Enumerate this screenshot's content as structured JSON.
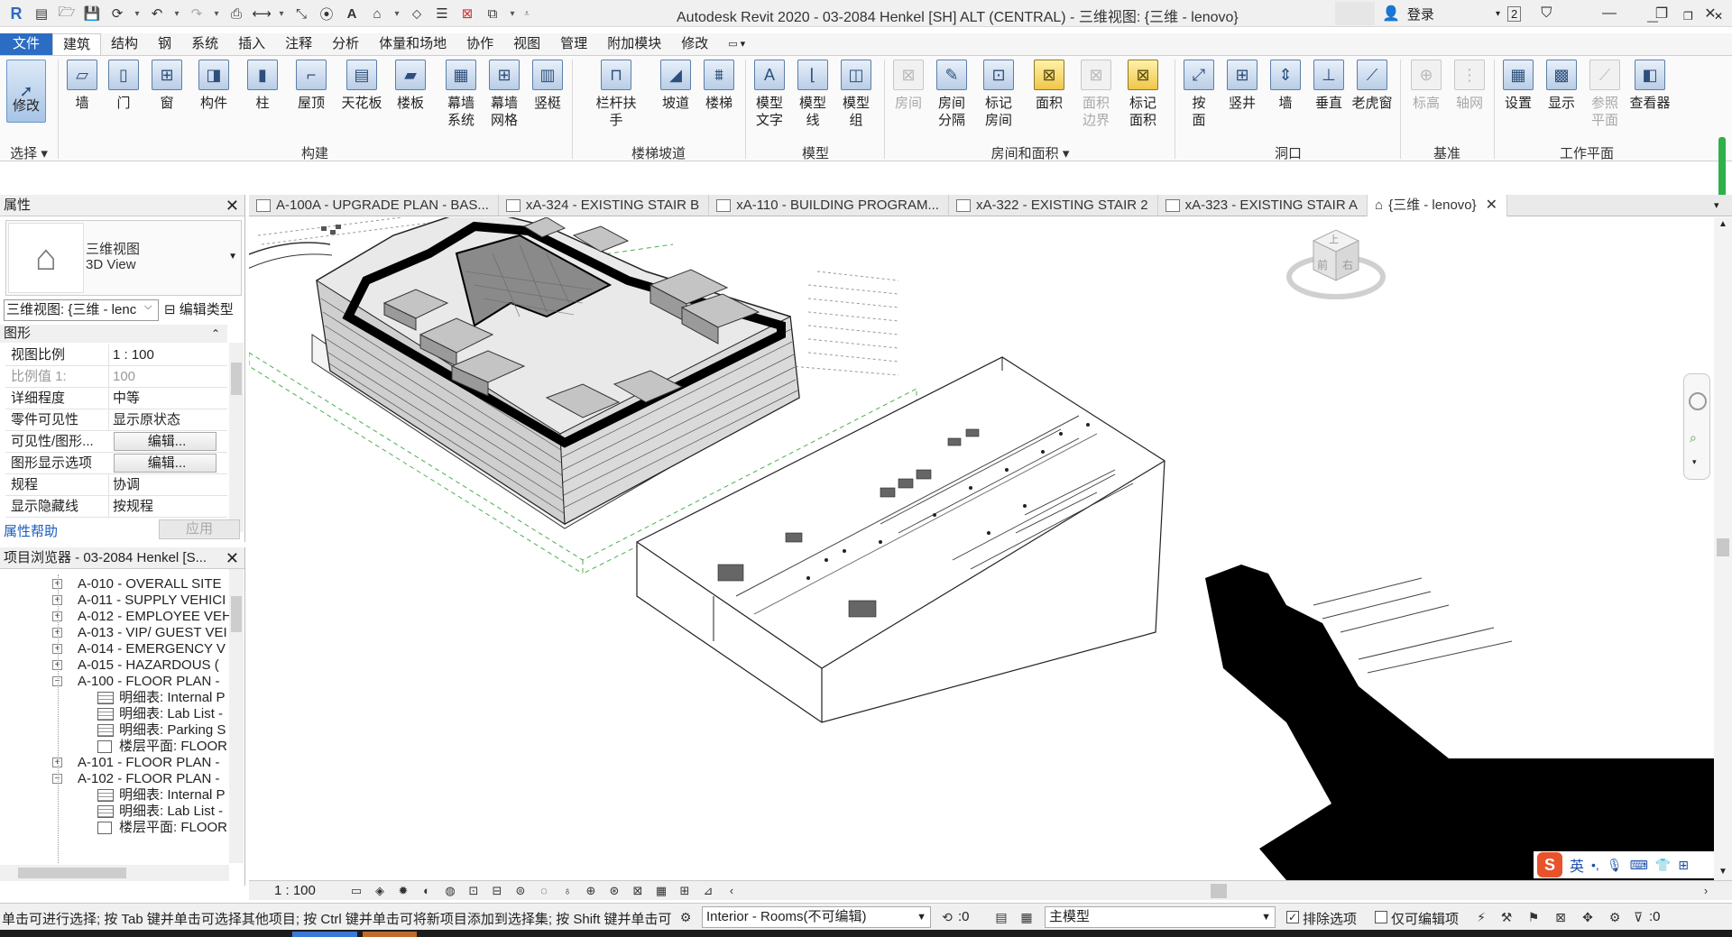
{
  "titlebar": {
    "title": "Autodesk Revit 2020 - 03-2084 Henkel [SH] ALT (CENTRAL) - 三维视图: {三维 - lenovo}",
    "login": "登录",
    "notif_count": "2"
  },
  "menu": {
    "tabs": [
      "文件",
      "建筑",
      "结构",
      "钢",
      "系统",
      "插入",
      "注释",
      "分析",
      "体量和场地",
      "协作",
      "视图",
      "管理",
      "附加模块",
      "修改"
    ]
  },
  "ribbon": {
    "select": {
      "label": "修改",
      "group": "选择"
    },
    "build": {
      "group": "构建",
      "items": [
        "墙",
        "门",
        "窗",
        "构件",
        "柱",
        "屋顶",
        "天花板",
        "楼板",
        "幕墙\n系统",
        "幕墙\n网格",
        "竖梃"
      ]
    },
    "stairs": {
      "group": "楼梯坡道",
      "items": [
        "栏杆扶手",
        "坡道",
        "楼梯"
      ]
    },
    "model": {
      "group": "模型",
      "items": [
        "模型\n文字",
        "模型\n线",
        "模型\n组"
      ]
    },
    "room": {
      "group": "房间和面积",
      "items": [
        "房间",
        "房间\n分隔",
        "标记\n房间",
        "面积",
        "面积\n边界",
        "标记\n面积"
      ]
    },
    "opening": {
      "group": "洞口",
      "items": [
        "按\n面",
        "竖井",
        "墙",
        "垂直",
        "老虎窗"
      ]
    },
    "datum": {
      "group": "基准",
      "items": [
        "标高",
        "轴网"
      ]
    },
    "workplane": {
      "group": "工作平面",
      "items": [
        "设置",
        "显示",
        "参照\n平面",
        "查看器"
      ]
    }
  },
  "properties": {
    "title": "属性",
    "type_line1": "三维视图",
    "type_line2": "3D View",
    "view_selector": "三维视图: {三维 - lenc",
    "edit_type": "编辑类型",
    "group": "图形",
    "rows": [
      {
        "k": "视图比例",
        "v": "1 : 100"
      },
      {
        "k": "比例值 1:",
        "v": "100"
      },
      {
        "k": "详细程度",
        "v": "中等"
      },
      {
        "k": "零件可见性",
        "v": "显示原状态"
      },
      {
        "k": "可见性/图形...",
        "v": "编辑..."
      },
      {
        "k": "图形显示选项",
        "v": "编辑..."
      },
      {
        "k": "规程",
        "v": "协调"
      },
      {
        "k": "显示隐藏线",
        "v": "按规程"
      }
    ],
    "help": "属性帮助",
    "apply": "应用"
  },
  "browser": {
    "title": "项目浏览器 - 03-2084 Henkel [S...",
    "items": [
      {
        "t": "A-010 - OVERALL SITE",
        "lvl": 1,
        "box": "+"
      },
      {
        "t": "A-011 - SUPPLY VEHICI",
        "lvl": 1,
        "box": "+"
      },
      {
        "t": "A-012 - EMPLOYEE VEH",
        "lvl": 1,
        "box": "+"
      },
      {
        "t": "A-013 - VIP/ GUEST VEI",
        "lvl": 1,
        "box": "+"
      },
      {
        "t": "A-014 - EMERGENCY V",
        "lvl": 1,
        "box": "+"
      },
      {
        "t": "A-015 - HAZARDOUS (",
        "lvl": 1,
        "box": "+"
      },
      {
        "t": "A-100 - FLOOR PLAN -",
        "lvl": 1,
        "box": "−"
      },
      {
        "t": "明细表: Internal P",
        "lvl": 2,
        "ic": "sched"
      },
      {
        "t": "明细表: Lab List -",
        "lvl": 2,
        "ic": "sched"
      },
      {
        "t": "明细表: Parking S",
        "lvl": 2,
        "ic": "sched"
      },
      {
        "t": "楼层平面: FLOOR",
        "lvl": 2,
        "ic": "plan"
      },
      {
        "t": "A-101 - FLOOR PLAN -",
        "lvl": 1,
        "box": "+"
      },
      {
        "t": "A-102 - FLOOR PLAN -",
        "lvl": 1,
        "box": "−"
      },
      {
        "t": "明细表: Internal P",
        "lvl": 2,
        "ic": "sched"
      },
      {
        "t": "明细表: Lab List -",
        "lvl": 2,
        "ic": "sched"
      },
      {
        "t": "楼层平面: FLOOR",
        "lvl": 2,
        "ic": "plan"
      }
    ]
  },
  "viewtabs": [
    "A-100A - UPGRADE PLAN - BAS...",
    "xA-324 - EXISTING STAIR B",
    "xA-110 - BUILDING PROGRAM...",
    "xA-322 - EXISTING STAIR 2",
    "xA-323 - EXISTING STAIR A",
    "{三维 - lenovo}"
  ],
  "viewcube": {
    "top": "上",
    "front": "前",
    "right": "右"
  },
  "viewbar": {
    "scale": "1 : 100"
  },
  "ime": {
    "lang": "英"
  },
  "status": {
    "hint": "单击可进行选择; 按 Tab 键并单击可选择其他项目; 按 Ctrl 键并单击可将新项目添加到选择集; 按 Shift 键并单击可",
    "workset": "Interior - Rooms(不可编辑)",
    "count_a": ":0",
    "model": "主模型",
    "exclude": "排除选项",
    "editable_only": "仅可编辑项",
    "filter_count": ":0"
  }
}
